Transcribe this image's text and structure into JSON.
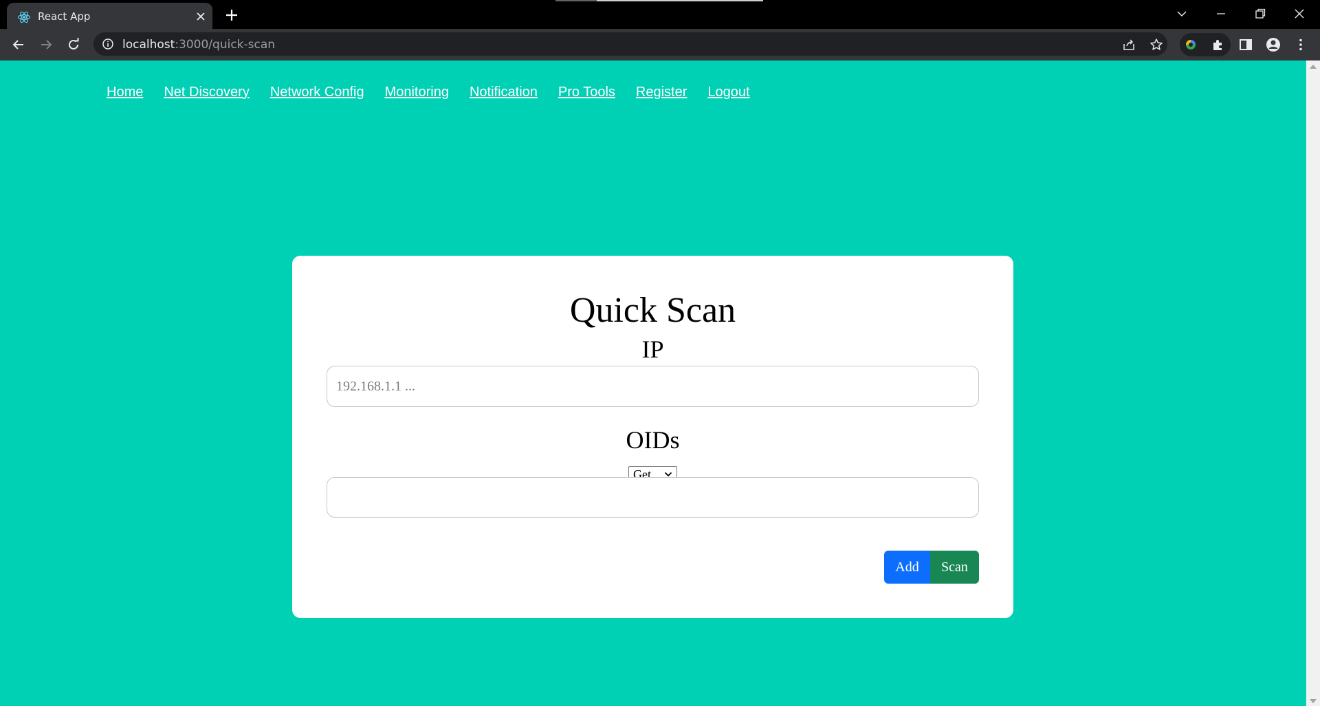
{
  "browser": {
    "tab_title": "React App",
    "url_host": "localhost",
    "url_path": ":3000/quick-scan"
  },
  "nav": {
    "items": [
      "Home",
      "Net Discovery",
      "Network Config",
      "Monitoring",
      "Notification",
      "Pro Tools",
      "Register",
      "Logout"
    ]
  },
  "quick_scan": {
    "title": "Quick Scan",
    "ip_label": "IP",
    "ip_placeholder": "192.168.1.1 ...",
    "ip_value": "",
    "oids_label": "OIDs",
    "method_selected": "Get",
    "oid_value": "",
    "add_label": "Add",
    "scan_label": "Scan"
  },
  "colors": {
    "page_background": "#00d0b4",
    "card_background": "#ffffff",
    "add_button": "#0d6efd",
    "scan_button": "#198754",
    "nav_link": "#ffffff",
    "chrome_dark": "#35363a"
  },
  "icons": {
    "tab": [
      "react-logo-icon",
      "close-icon",
      "plus-icon"
    ],
    "toolbar": [
      "back-arrow-icon",
      "forward-arrow-icon",
      "reload-icon",
      "info-icon",
      "share-icon",
      "star-icon",
      "extension-icon",
      "puzzle-icon",
      "side-panel-icon",
      "profile-icon",
      "kebab-menu-icon"
    ],
    "window": [
      "chevron-down-icon",
      "minimize-icon",
      "restore-icon",
      "close-icon"
    ],
    "select": "chevron-down-icon"
  }
}
